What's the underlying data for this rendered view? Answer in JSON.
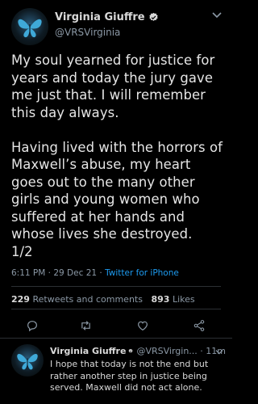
{
  "tweet": {
    "author_name": "Virginia Giuffre",
    "author_handle": "@VRSVirginia",
    "text": "My soul yearned for justice for years and today the jury gave me just that. I will remember this day always.\n\nHaving lived with the horrors of Maxwell’s abuse, my heart goes out to the many other girls and young women who suffered at her hands and whose lives she destroyed.\n1/2",
    "time": "6:11 PM",
    "date": "29 Dec 21",
    "client": "Twitter for iPhone",
    "retweets_count": "229",
    "retweets_label": "Retweets and comments",
    "likes_count": "893",
    "likes_label": "Likes"
  },
  "reply": {
    "author_name": "Virginia Giuffre",
    "handle_time": "@VRSVirgin... · 11m",
    "text": "I hope that today is not the end but rather another step in justice being served. Maxwell did not act alone."
  },
  "colors": {
    "background": "#000000",
    "text": "#d9d9d9",
    "secondary": "#8b98a5",
    "accent": "#1d9bf0"
  },
  "icons": [
    "butterfly-avatar",
    "verified-badge-icon",
    "chevron-down-icon",
    "reply-icon",
    "retweet-icon",
    "like-icon",
    "share-icon"
  ]
}
